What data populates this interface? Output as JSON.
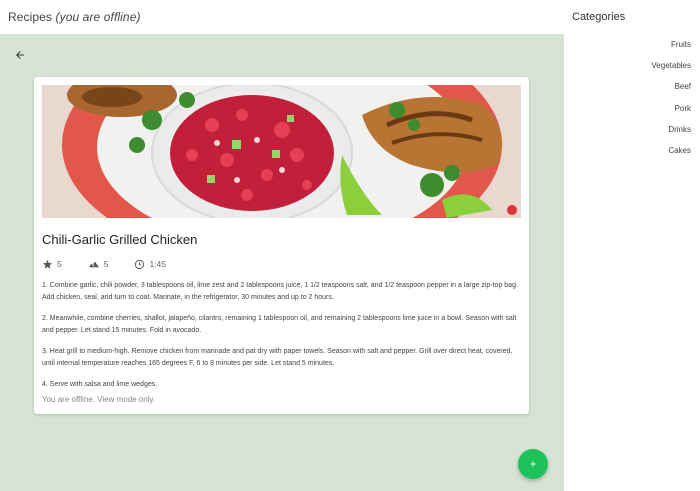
{
  "header": {
    "title": "Recipes",
    "offline_label": "(you are offline)"
  },
  "recipe": {
    "title": "Chili-Garlic Grilled Chicken",
    "rating": "5",
    "difficulty": "5",
    "time": "1:45",
    "steps": [
      "1. Combine garlic, chili powder, 3 tablespoons oil, lime zest and 2 tablespoons juice, 1 1/2 teaspoons salt, and 1/2 teaspoon pepper in a large zip-top bag. Add chicken, seal, and turn to coat. Marinate, in the refrigerator, 30 minutes and up to 2 hours.",
      "2. Meanwhile, combine cherries, shallot, jalapeño, cilantro, remaining 1 tablespoon oil, and remaining 2 tablespoons lime juice in a bowl. Season with salt and pepper. Let stand 15 minutes. Fold in avocado.",
      "3. Heat grill to medium-high. Remove chicken from marinade and pat dry with paper towels. Season with salt and pepper. Grill over direct heat, covered, until internal temperature reaches 165 degrees F, 6 to 8 minutes per side. Let stand 5 minutes.",
      "4. Serve with salsa and lime wedges."
    ],
    "offline_note": "You are offline. View mode only."
  },
  "sidebar": {
    "title": "Categories",
    "items": [
      "Fruits",
      "Vegetables",
      "Beef",
      "Pork",
      "Drinks",
      "Cakes"
    ]
  },
  "icons": {
    "back": "arrow-left-icon",
    "rating": "star-icon",
    "difficulty": "mountain-icon",
    "time": "clock-icon",
    "add": "plus-icon"
  },
  "colors": {
    "main_background": "#d6e5d3",
    "fab": "#1ec25a"
  }
}
